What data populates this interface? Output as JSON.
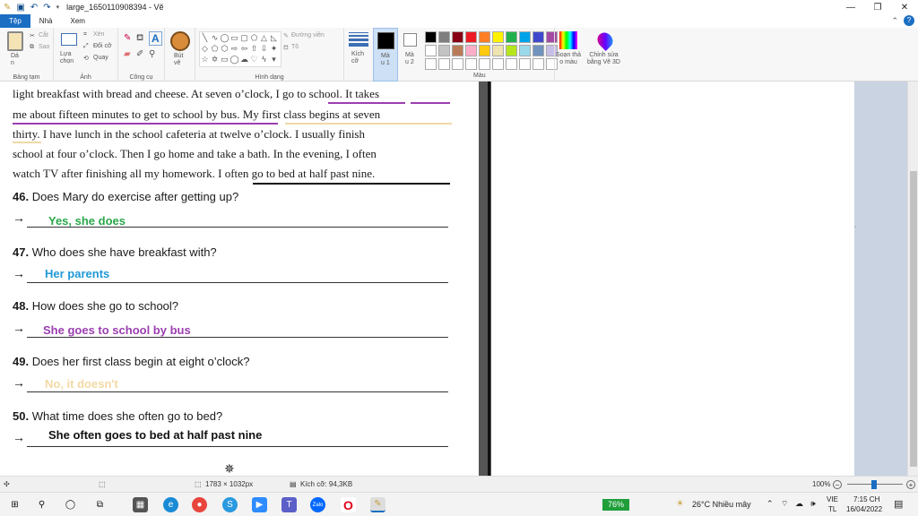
{
  "window": {
    "title": "large_1650110908394 - Vẽ"
  },
  "tabs": [
    {
      "label": "Tệp",
      "active": true
    },
    {
      "label": "Nhà",
      "active": false
    },
    {
      "label": "Xem",
      "active": false
    }
  ],
  "ribbon": {
    "clipboard": {
      "paste": "Dá\nn",
      "cut": "Cắt",
      "copy": "Sao",
      "label": "Bảng tạm"
    },
    "image": {
      "select": "Lựa\nchọn",
      "crop": "Xén",
      "resize": "Đổi cỡ",
      "rotate": "Quay",
      "label": "Ảnh"
    },
    "tools": {
      "label": "Công cụ"
    },
    "brushes": {
      "label": "Bút\nvẽ"
    },
    "shapes": {
      "outline": "Đường viền",
      "fill": "Tô",
      "label": "Hình dạng"
    },
    "size": {
      "label": "Kích\ncỡ"
    },
    "color1": {
      "label": "Mà\nu 1"
    },
    "color2": {
      "label": "Mà\nu 2"
    },
    "colors": {
      "label": "Màu"
    },
    "edit_colors": {
      "label": "Soạn thả\no màu"
    },
    "paint3d": {
      "label": "Chỉnh sửa\nbằng Vẽ 3D"
    },
    "palette": [
      "#000000",
      "#7f7f7f",
      "#880015",
      "#ed1c24",
      "#ff7f27",
      "#fff200",
      "#22b14c",
      "#00a2e8",
      "#3f48cc",
      "#a349a4",
      "#ffffff",
      "#c3c3c3",
      "#b97a57",
      "#ffaec9",
      "#ffc90e",
      "#efe4b0",
      "#b5e61d",
      "#99d9ea",
      "#7092be",
      "#c8bfe7",
      "#ffffff",
      "#ffffff",
      "#ffffff",
      "#ffffff",
      "#ffffff",
      "#ffffff",
      "#ffffff",
      "#ffffff",
      "#ffffff",
      "#ffffff"
    ]
  },
  "document": {
    "passage": [
      "light breakfast with bread and cheese. At seven o’clock, I go to school. It takes",
      "me about fifteen minutes to get to school by bus.  My first class begins at seven",
      "thirty.  I have lunch in the school cafeteria at twelve o’clock. I usually finish",
      "school at four o’clock. Then I go home and take a bath. In the evening, I often",
      "watch TV after finishing all my homework. I often go to bed at half past nine."
    ],
    "questions": [
      {
        "num": "46.",
        "text": "Does Mary do exercise after getting up?",
        "answer": "Yes, she does",
        "color": "#2aa84a"
      },
      {
        "num": "47.",
        "text": "Who does she have breakfast with?",
        "answer": "Her parents",
        "color": "#1f9ad6"
      },
      {
        "num": "48.",
        "text": "How does she go to school?",
        "answer": "She goes to school by bus",
        "color": "#9b3fb0"
      },
      {
        "num": "49.",
        "text": "Does her first class begin at eight o’clock?",
        "answer": "No, it doesn't",
        "color": "#f3d9a4"
      },
      {
        "num": "50.",
        "text": "What time does she often go to bed?",
        "answer": "She often goes to bed at half past nine",
        "color": "#111111"
      }
    ],
    "arrow": "→"
  },
  "status": {
    "dimensions": "1783 × 1032px",
    "filesize": "Kích cỡ: 94,3KB",
    "zoom": "100%"
  },
  "taskbar": {
    "battery": "76%",
    "weather": "26°C  Nhiều mây",
    "lang": "VIE",
    "lang2": "TL",
    "time": "7:15 CH",
    "date": "16/04/2022"
  }
}
